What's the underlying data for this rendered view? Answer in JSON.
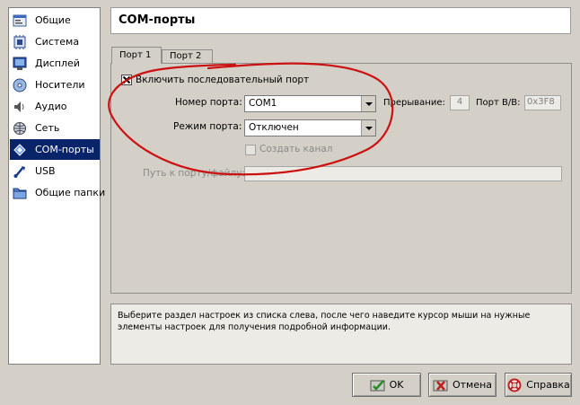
{
  "sidebar": {
    "items": [
      {
        "label": "Общие",
        "icon": "general-settings-icon"
      },
      {
        "label": "Система",
        "icon": "system-chip-icon"
      },
      {
        "label": "Дисплей",
        "icon": "display-monitor-icon"
      },
      {
        "label": "Носители",
        "icon": "storage-disk-icon"
      },
      {
        "label": "Аудио",
        "icon": "audio-speaker-icon"
      },
      {
        "label": "Сеть",
        "icon": "network-icon"
      },
      {
        "label": "COM-порты",
        "icon": "serial-port-icon"
      },
      {
        "label": "USB",
        "icon": "usb-icon"
      },
      {
        "label": "Общие папки",
        "icon": "shared-folder-icon"
      }
    ],
    "selected_index": 6
  },
  "page_title": "COM-порты",
  "tabs": [
    {
      "label": "Порт 1",
      "active": true
    },
    {
      "label": "Порт 2",
      "active": false
    }
  ],
  "port": {
    "enable_label": "Включить последовательный порт",
    "enabled": true,
    "port_number_label": "Номер порта:",
    "port_number_value": "COM1",
    "irq_label": "Прерывание:",
    "irq_value": "4",
    "io_port_label": "Порт В/В:",
    "io_port_value": "0x3F8",
    "mode_label": "Режим порта:",
    "mode_value": "Отключен",
    "create_pipe_label": "Создать канал",
    "path_label": "Путь к порту/файлу:",
    "path_value": ""
  },
  "info_text": "Выберите раздел настроек из списка слева, после чего наведите курсор мыши на нужные элементы настроек для получения подробной информации.",
  "buttons": {
    "ok": "OK",
    "cancel": "Отмена",
    "help": "Справка"
  },
  "colors": {
    "selection": "#0a246a",
    "annotation_ink": "#cc1111",
    "window_bg": "#d4d0c8"
  }
}
